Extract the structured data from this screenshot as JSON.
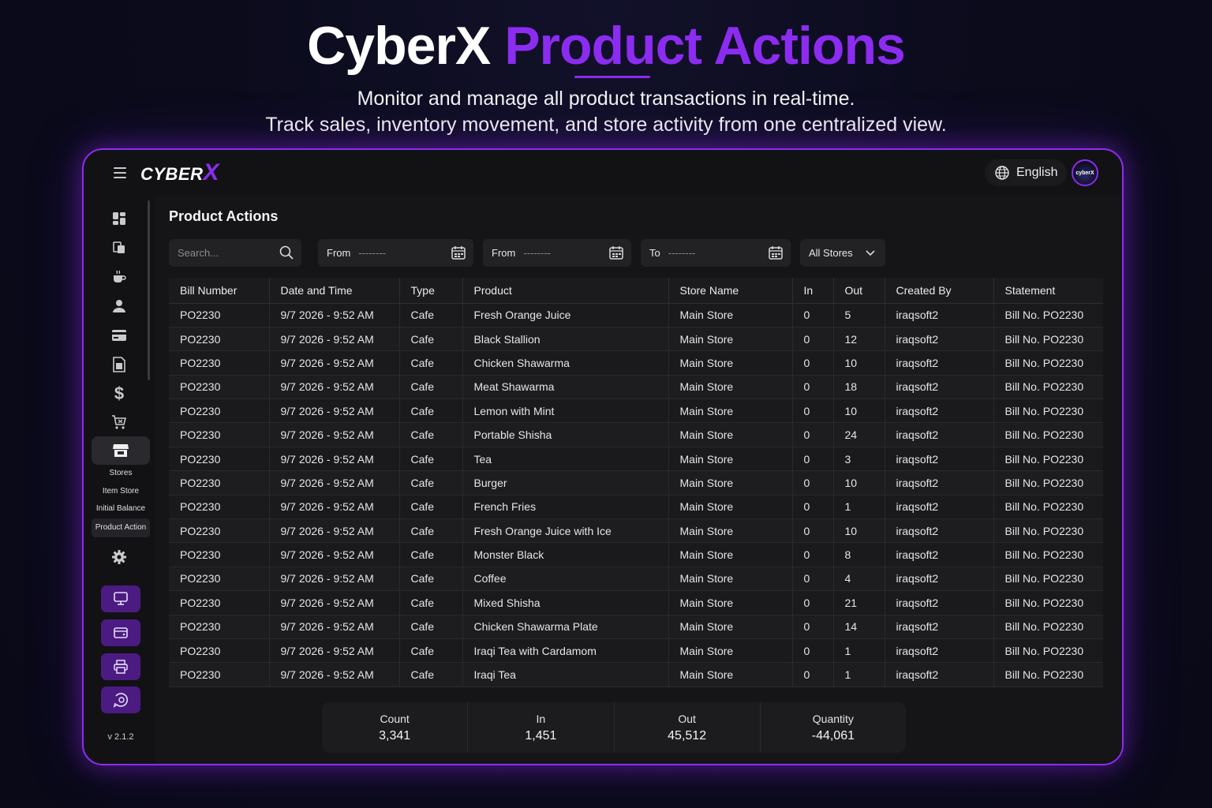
{
  "hero": {
    "title_white": "CyberX",
    "title_purple": "Product Actions",
    "subtitle_line1": "Monitor and manage all product transactions in real-time.",
    "subtitle_line2": "Track sales, inventory movement, and store activity from one centralized view."
  },
  "colors": {
    "accent": "#8b2cf0",
    "panel": "#121214",
    "purple_button": "#4b1b82"
  },
  "topbar": {
    "logo_text": "CYBER",
    "logo_x": "X",
    "language": "English",
    "avatar_text": "cyberX"
  },
  "sidebar": {
    "icons": [
      "dashboard-icon",
      "products-icon",
      "cafe-icon",
      "user-icon",
      "card-icon",
      "invoice-icon",
      "dollar-icon",
      "cart-icon",
      "store-icon",
      "gear-icon"
    ],
    "active_section": "Stores",
    "sub_items": [
      "Item Store",
      "Initial Balance",
      "Product Action"
    ],
    "active_sub_item": "Product Action",
    "bottom_buttons": [
      "monitor-icon",
      "wallet-icon",
      "printer-icon",
      "support-icon"
    ],
    "version": "v 2.1.2"
  },
  "main": {
    "title": "Product Actions",
    "filters": {
      "search_placeholder": "Search...",
      "from1_label": "From",
      "from1_value": "--------",
      "from2_label": "From",
      "from2_value": "--------",
      "to_label": "To",
      "to_value": "--------",
      "store_select": "All Stores"
    }
  },
  "table": {
    "columns": [
      "Bill Number",
      "Date and Time",
      "Type",
      "Product",
      "Store Name",
      "In",
      "Out",
      "Created By",
      "Statement"
    ],
    "rows": [
      [
        "PO2230",
        "9/7 2026 - 9:52 AM",
        "Cafe",
        "Fresh Orange Juice",
        "Main Store",
        "0",
        "5",
        "iraqsoft2",
        "Bill No. PO2230"
      ],
      [
        "PO2230",
        "9/7 2026 - 9:52 AM",
        "Cafe",
        "Black Stallion",
        "Main Store",
        "0",
        "12",
        "iraqsoft2",
        "Bill No. PO2230"
      ],
      [
        "PO2230",
        "9/7 2026 - 9:52 AM",
        "Cafe",
        "Chicken Shawarma",
        "Main Store",
        "0",
        "10",
        "iraqsoft2",
        "Bill No. PO2230"
      ],
      [
        "PO2230",
        "9/7 2026 - 9:52 AM",
        "Cafe",
        "Meat Shawarma",
        "Main Store",
        "0",
        "18",
        "iraqsoft2",
        "Bill No. PO2230"
      ],
      [
        "PO2230",
        "9/7 2026 - 9:52 AM",
        "Cafe",
        "Lemon with Mint",
        "Main Store",
        "0",
        "10",
        "iraqsoft2",
        "Bill No. PO2230"
      ],
      [
        "PO2230",
        "9/7 2026 - 9:52 AM",
        "Cafe",
        "Portable Shisha",
        "Main Store",
        "0",
        "24",
        "iraqsoft2",
        "Bill No. PO2230"
      ],
      [
        "PO2230",
        "9/7 2026 - 9:52 AM",
        "Cafe",
        "Tea",
        "Main Store",
        "0",
        "3",
        "iraqsoft2",
        "Bill No. PO2230"
      ],
      [
        "PO2230",
        "9/7 2026 - 9:52 AM",
        "Cafe",
        "Burger",
        "Main Store",
        "0",
        "10",
        "iraqsoft2",
        "Bill No. PO2230"
      ],
      [
        "PO2230",
        "9/7 2026 - 9:52 AM",
        "Cafe",
        "French Fries",
        "Main Store",
        "0",
        "1",
        "iraqsoft2",
        "Bill No. PO2230"
      ],
      [
        "PO2230",
        "9/7 2026 - 9:52 AM",
        "Cafe",
        "Fresh Orange Juice with Ice",
        "Main Store",
        "0",
        "10",
        "iraqsoft2",
        "Bill No. PO2230"
      ],
      [
        "PO2230",
        "9/7 2026 - 9:52 AM",
        "Cafe",
        "Monster Black",
        "Main Store",
        "0",
        "8",
        "iraqsoft2",
        "Bill No. PO2230"
      ],
      [
        "PO2230",
        "9/7 2026 - 9:52 AM",
        "Cafe",
        "Coffee",
        "Main Store",
        "0",
        "4",
        "iraqsoft2",
        "Bill No. PO2230"
      ],
      [
        "PO2230",
        "9/7 2026 - 9:52 AM",
        "Cafe",
        "Mixed Shisha",
        "Main Store",
        "0",
        "21",
        "iraqsoft2",
        "Bill No. PO2230"
      ],
      [
        "PO2230",
        "9/7 2026 - 9:52 AM",
        "Cafe",
        "Chicken Shawarma Plate",
        "Main Store",
        "0",
        "14",
        "iraqsoft2",
        "Bill No. PO2230"
      ],
      [
        "PO2230",
        "9/7 2026 - 9:52 AM",
        "Cafe",
        "Iraqi Tea with Cardamom",
        "Main Store",
        "0",
        "1",
        "iraqsoft2",
        "Bill No. PO2230"
      ],
      [
        "PO2230",
        "9/7 2026 - 9:52 AM",
        "Cafe",
        "Iraqi Tea",
        "Main Store",
        "0",
        "1",
        "iraqsoft2",
        "Bill No. PO2230"
      ]
    ]
  },
  "summary": {
    "count_label": "Count",
    "count_value": "3,341",
    "in_label": "In",
    "in_value": "1,451",
    "out_label": "Out",
    "out_value": "45,512",
    "quantity_label": "Quantity",
    "quantity_value": "-44,061"
  }
}
